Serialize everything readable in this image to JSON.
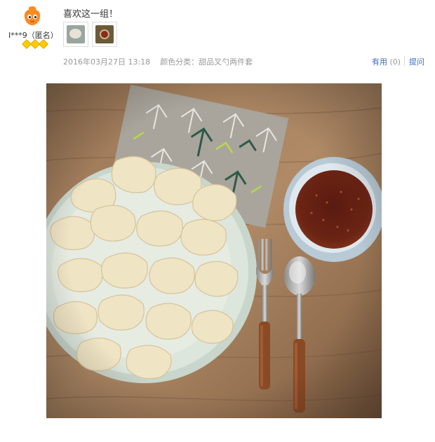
{
  "review": {
    "user": {
      "name": "I***9",
      "anon": "（匿名）",
      "avatar": "tmall-mascot-avatar",
      "badge_count": 3
    },
    "comment": "喜欢这一组！",
    "thumbnails": [
      "dumplings-thumb",
      "sauce-thumb"
    ],
    "date": "2016年03月27日 13:18",
    "category": "颜色分类：甜品叉勺两件套",
    "useful_label": "有用",
    "useful_count": "(0)",
    "reply_label": "提问"
  },
  "photo": {
    "subject": "dumplings with fork, spoon and sauce"
  }
}
